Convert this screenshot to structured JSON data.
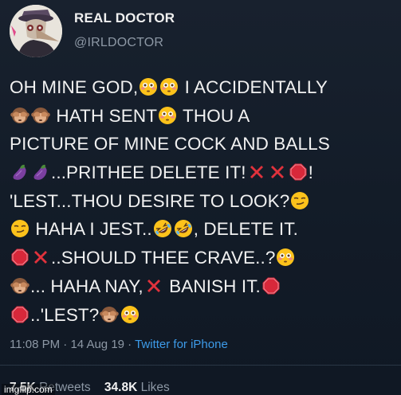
{
  "header": {
    "display_name": "REAL DOCTOR",
    "handle": "@IRLDOCTOR",
    "avatar_icon": "plague-doctor-avatar"
  },
  "tweet": {
    "lines": [
      [
        {
          "t": "OH MINE GOD,"
        },
        {
          "e": "flushed-face-icon"
        },
        {
          "e": "flushed-face-icon"
        },
        {
          "t": " I ACCIDENTALLY"
        }
      ],
      [
        {
          "e": "see-no-evil-monkey-icon"
        },
        {
          "e": "see-no-evil-monkey-icon"
        },
        {
          "t": " HATH SENT"
        },
        {
          "e": "flushed-face-icon"
        },
        {
          "t": " THOU A"
        }
      ],
      [
        {
          "t": "PICTURE OF MINE COCK AND BALLS"
        }
      ],
      [
        {
          "e": "eggplant-icon"
        },
        {
          "e": "eggplant-icon"
        },
        {
          "t": "...PRITHEE DELETE IT!"
        },
        {
          "e": "cross-mark-icon"
        },
        {
          "e": "cross-mark-icon"
        },
        {
          "e": "stop-sign-icon"
        },
        {
          "t": "!"
        }
      ],
      [
        {
          "t": "'LEST...THOU DESIRE TO LOOK?"
        },
        {
          "e": "smirking-face-icon"
        }
      ],
      [
        {
          "e": "smirking-face-icon"
        },
        {
          "t": " HAHA I JEST.."
        },
        {
          "e": "rofl-face-icon"
        },
        {
          "e": "rofl-face-icon"
        },
        {
          "t": ", DELETE IT."
        }
      ],
      [
        {
          "e": "stop-sign-icon"
        },
        {
          "e": "cross-mark-icon"
        },
        {
          "t": "..SHOULD THEE CRAVE..?"
        },
        {
          "e": "flushed-face-icon"
        }
      ],
      [
        {
          "e": "see-no-evil-monkey-icon"
        },
        {
          "t": "... HAHA NAY,"
        },
        {
          "e": "cross-mark-icon"
        },
        {
          "t": " BANISH IT."
        },
        {
          "e": "stop-sign-icon"
        }
      ],
      [
        {
          "e": "stop-sign-icon"
        },
        {
          "t": "..'LEST?"
        },
        {
          "e": "see-no-evil-monkey-icon"
        },
        {
          "e": "flushed-face-icon"
        }
      ]
    ]
  },
  "meta": {
    "time": "11:08 PM",
    "separator1": " · ",
    "date": "14 Aug 19",
    "separator2": " · ",
    "source": "Twitter for iPhone"
  },
  "stats": {
    "retweets_count": "7.5K",
    "retweets_label": "Retweets",
    "likes_count": "34.8K",
    "likes_label": "Likes"
  },
  "watermark": "imgflip.com",
  "colors": {
    "background": "#131d2a",
    "text": "#f1f1f1",
    "muted": "#8d98a5",
    "link": "#3d9be9",
    "cross": "#e0323c",
    "stop": "#d8283a"
  }
}
